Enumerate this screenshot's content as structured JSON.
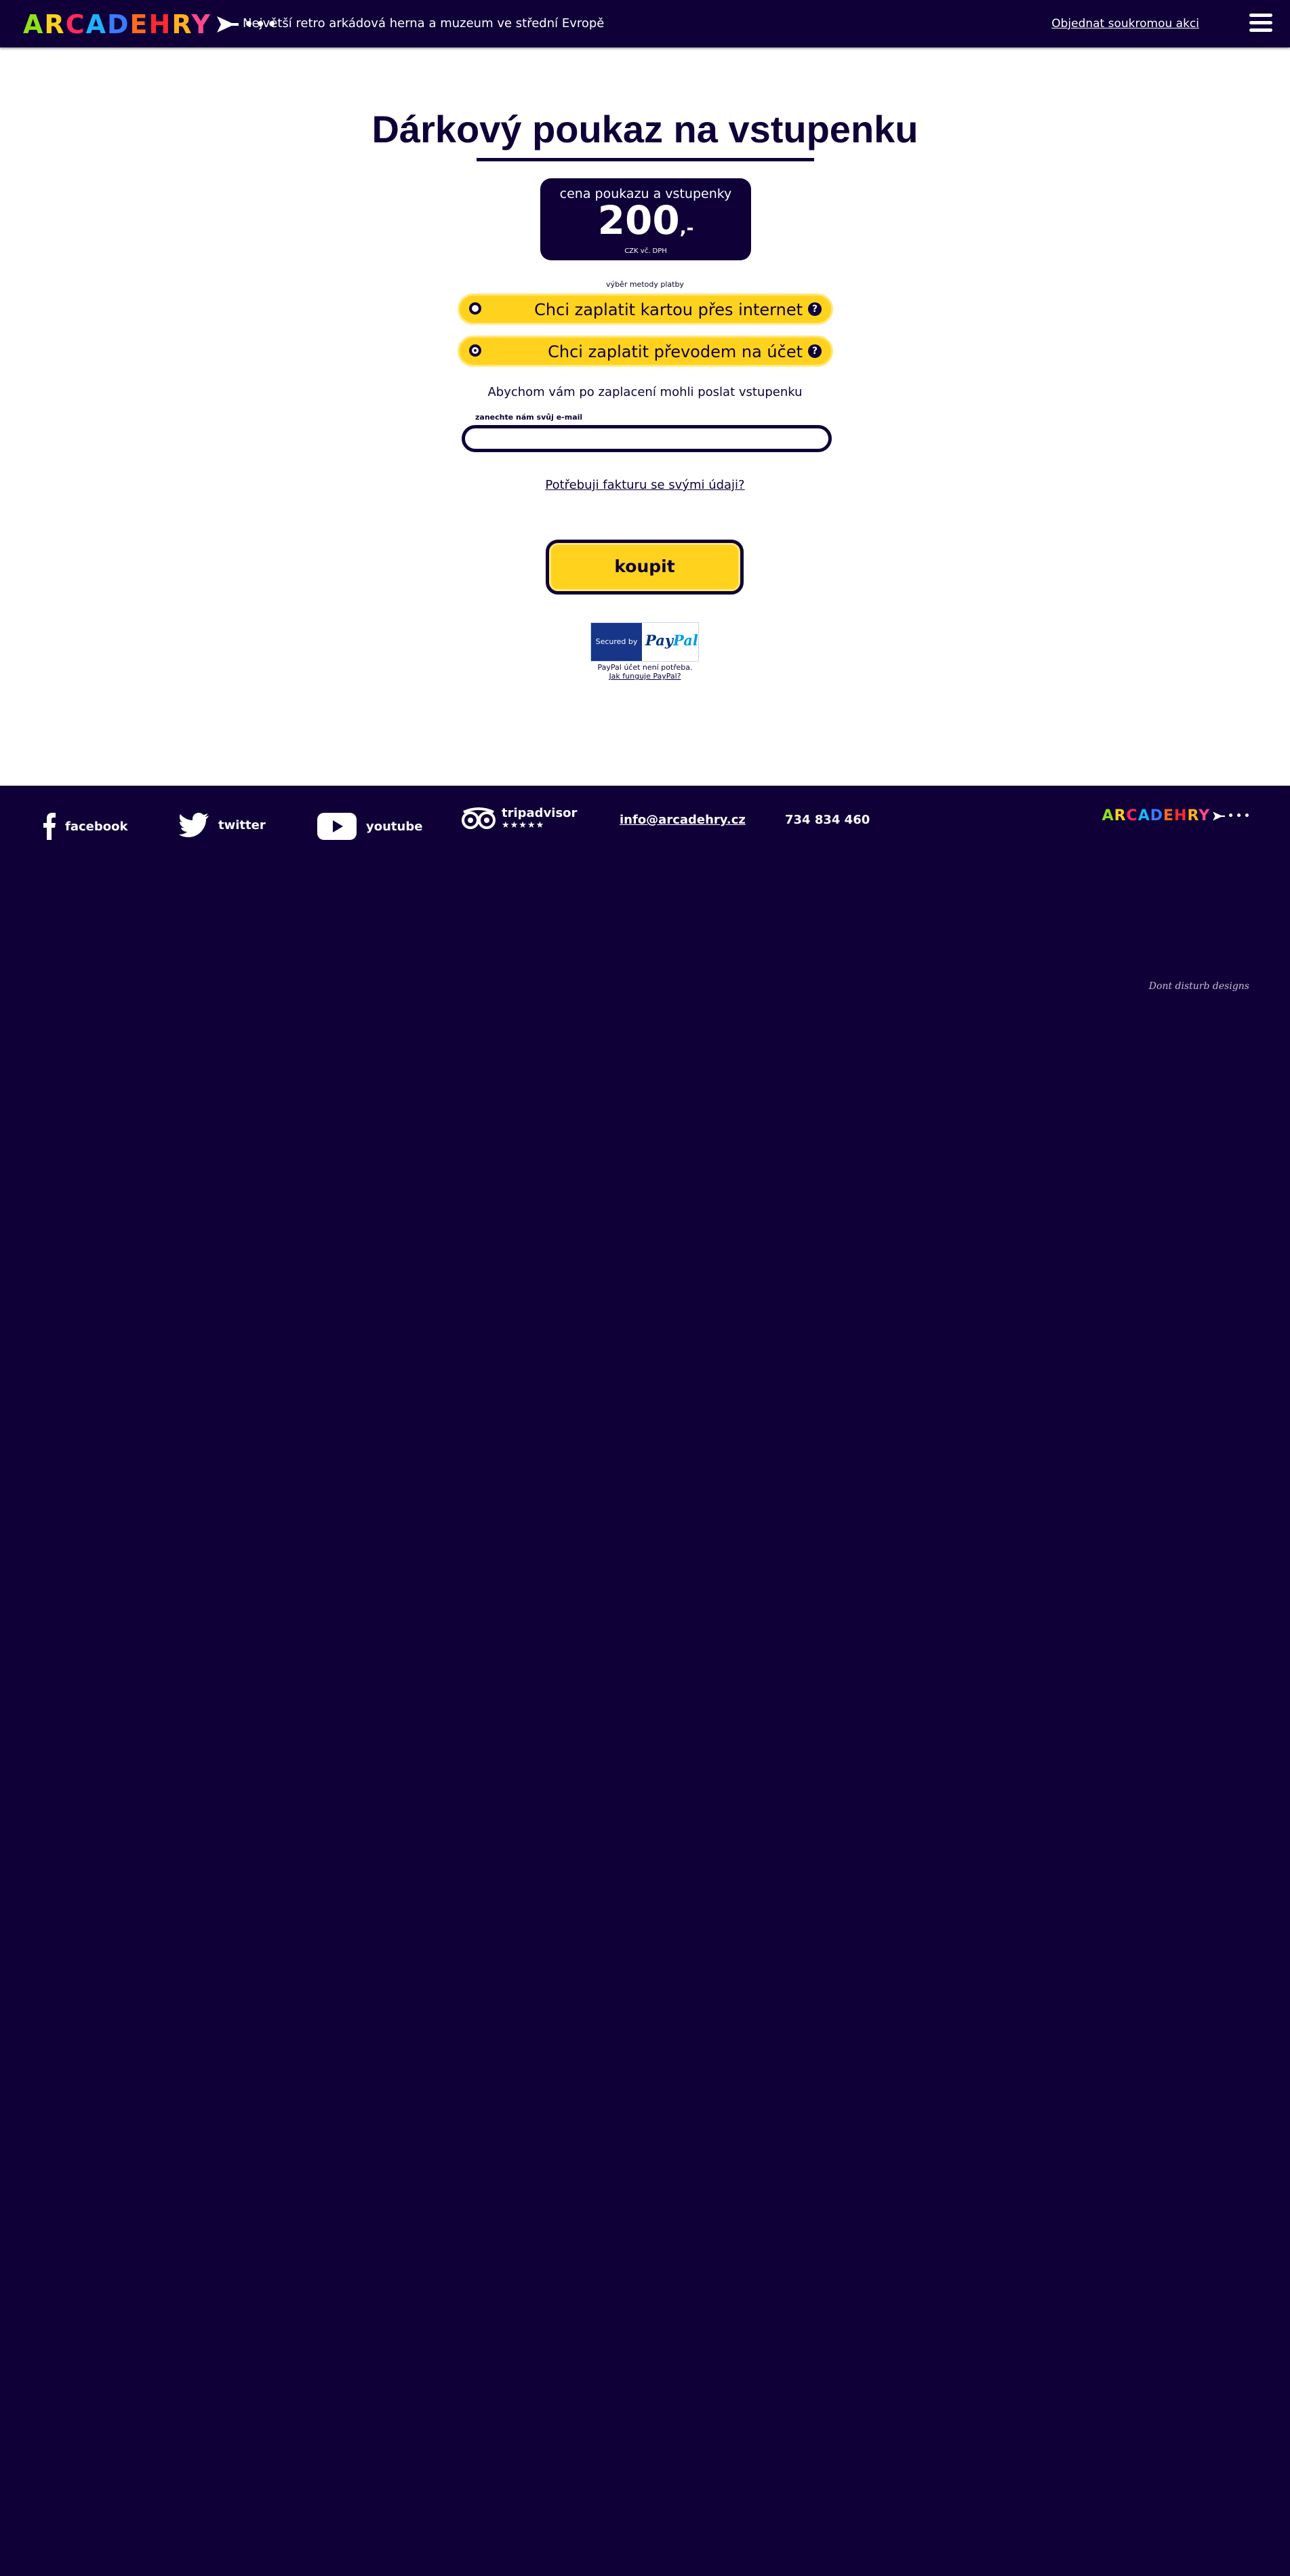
{
  "header": {
    "logo_text": "ARCADEHRY",
    "tagline": "Největší retro arkádová herna a muzeum ve střední Evropě",
    "order_link": "Objednat soukromou akci",
    "menu_icon": "hamburger-menu-icon"
  },
  "main": {
    "title": "Dárkový poukaz na vstupenku",
    "price": {
      "caption": "cena poukazu a vstupenky",
      "value": "200",
      "suffix": ",-",
      "note": "CZK vč. DPH"
    },
    "payment": {
      "label": "výběr metody platby",
      "options": [
        {
          "label": "Chci zaplatit kartou přes internet",
          "selected": false
        },
        {
          "label": "Chci zaplatit převodem na účet",
          "selected": true
        }
      ],
      "help_icon_text": "?"
    },
    "info_text": "Abychom vám po zaplacení mohli poslat vstupenku",
    "email": {
      "label": "zanechte nám svůj e-mail",
      "value": "",
      "placeholder": ""
    },
    "invoice_link": "Potřebuji fakturu se svými údaji?",
    "buy_button": "koupit",
    "paypal": {
      "secured_by": "Secured by",
      "pay": "Pay",
      "pal": "Pal",
      "note": "PayPal účet není potřeba.",
      "how_link": "Jak funguje PayPal?"
    }
  },
  "footer": {
    "facebook": "facebook",
    "twitter": "twitter",
    "youtube": "youtube",
    "tripadvisor": "tripadvisor",
    "rating": "★★★★★",
    "email": "info@arcadehry.cz",
    "phone": "734 834 460",
    "logo_text": "ARCADEHRY",
    "signature": "Dont disturb designs"
  },
  "colors": {
    "navy": "#0f0038",
    "yellow": "#ffd21e",
    "logo": [
      "#8ee21a",
      "#ffd21e",
      "#ff2a5e",
      "#1fb3ff",
      "#3a7bff",
      "#ff6a1f",
      "#ff2a2a",
      "#ffb21e",
      "#ff4a8a"
    ]
  }
}
